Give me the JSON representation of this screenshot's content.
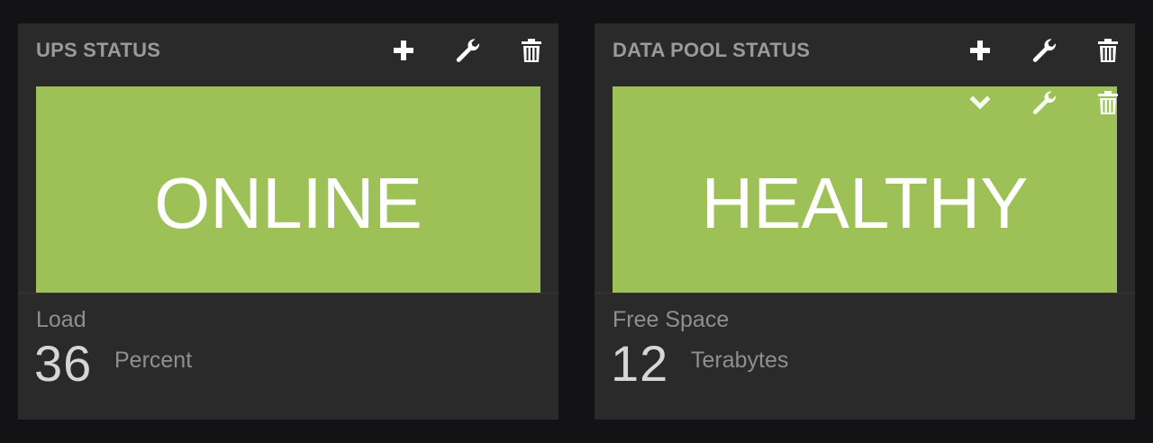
{
  "colors": {
    "page_background": "#131315",
    "panel_background": "#2a2a2b",
    "status_ok": "#9dc057",
    "header_text": "#9a9a9a",
    "icon": "#ffffff"
  },
  "widgets": [
    {
      "title": "UPS STATUS",
      "header_buttons": [
        {
          "icon": "plus-icon"
        },
        {
          "icon": "wrench-icon"
        },
        {
          "icon": "trash-icon"
        }
      ],
      "status": "ONLINE",
      "metric": {
        "label": "Load",
        "value": "36",
        "unit": "Percent"
      }
    },
    {
      "title": "DATA POOL STATUS",
      "header_buttons": [
        {
          "icon": "plus-icon"
        },
        {
          "icon": "wrench-icon"
        },
        {
          "icon": "trash-icon"
        }
      ],
      "tile_buttons": [
        {
          "icon": "chevron-down-icon"
        },
        {
          "icon": "wrench-icon"
        },
        {
          "icon": "trash-icon"
        }
      ],
      "status": "HEALTHY",
      "metric": {
        "label": "Free Space",
        "value": "12",
        "unit": "Terabytes"
      }
    }
  ]
}
